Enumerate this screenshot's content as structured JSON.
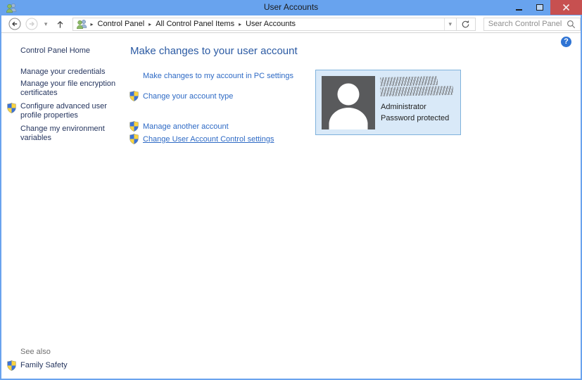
{
  "window": {
    "title": "User Accounts",
    "accent_color": "#68a3ee",
    "close_button_color": "#c75050"
  },
  "toolbar": {
    "breadcrumb": [
      "Control Panel",
      "All Control Panel Items",
      "User Accounts"
    ],
    "search_placeholder": "Search Control Panel"
  },
  "icons": {
    "breadcrumb_sep": "▸",
    "chevron_down": "▾",
    "help_glyph": "?"
  },
  "sidebar": {
    "home_label": "Control Panel Home",
    "items": [
      {
        "label": "Manage your credentials",
        "shield": false
      },
      {
        "label": "Manage your file encryption certificates",
        "shield": false
      },
      {
        "label": "Configure advanced user profile properties",
        "shield": true
      },
      {
        "label": "Change my environment variables",
        "shield": false
      }
    ],
    "see_also_label": "See also",
    "family_safety_label": "Family Safety"
  },
  "main": {
    "heading": "Make changes to your user account",
    "links": [
      {
        "label": "Make changes to my account in PC settings",
        "shield": false,
        "underlined": false
      },
      {
        "label": "Change your account type",
        "shield": true,
        "underlined": false
      },
      {
        "label": "Manage another account",
        "shield": true,
        "underlined": false
      },
      {
        "label": "Change User Account Control settings",
        "shield": true,
        "underlined": true
      }
    ]
  },
  "account_tile": {
    "name_redacted": true,
    "role": "Administrator",
    "status": "Password protected"
  }
}
